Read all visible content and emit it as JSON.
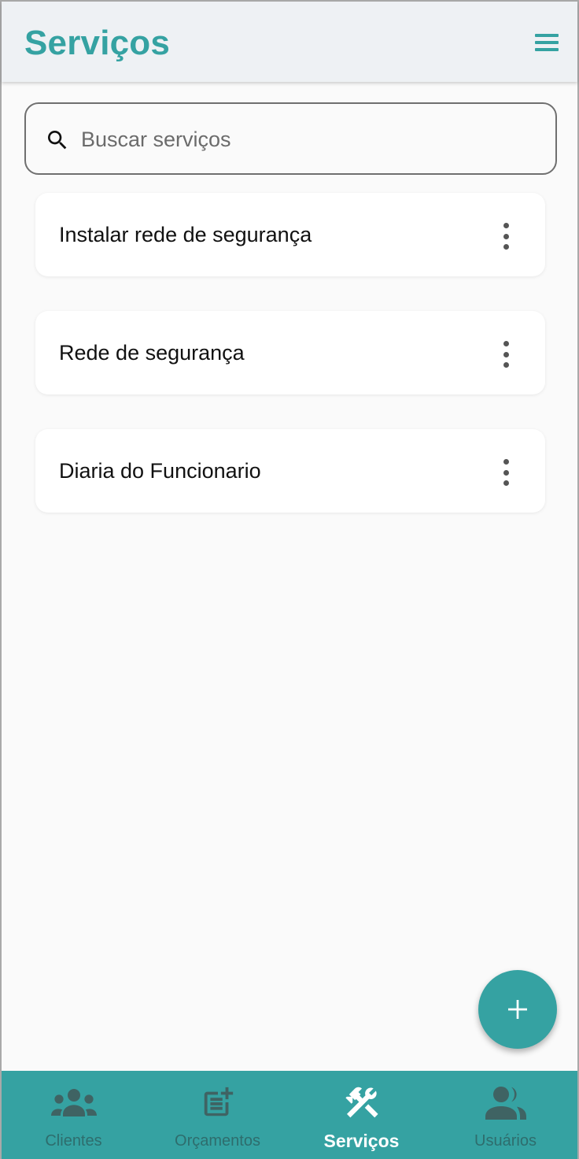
{
  "header": {
    "title": "Serviços",
    "menu_icon": "hamburger-menu-icon"
  },
  "search": {
    "placeholder": "Buscar serviços",
    "value": "",
    "icon": "search-icon"
  },
  "services": [
    {
      "name": "Instalar rede de segurança"
    },
    {
      "name": "Rede de segurança"
    },
    {
      "name": "Diaria do Funcionario"
    }
  ],
  "fab": {
    "icon": "plus-icon"
  },
  "bottom_nav": {
    "items": [
      {
        "label": "Clientes",
        "icon": "groups-icon",
        "active": false
      },
      {
        "label": "Orçamentos",
        "icon": "post-add-icon",
        "active": false
      },
      {
        "label": "Serviços",
        "icon": "tools-icon",
        "active": true
      },
      {
        "label": "Usuários",
        "icon": "people-icon",
        "active": false
      }
    ]
  },
  "colors": {
    "primary": "#35a2a2",
    "appbar_bg": "#eef1f4",
    "page_bg": "#fafafa",
    "inactive_nav": "#2e6d6d",
    "inactive_icon": "#3f6363"
  }
}
